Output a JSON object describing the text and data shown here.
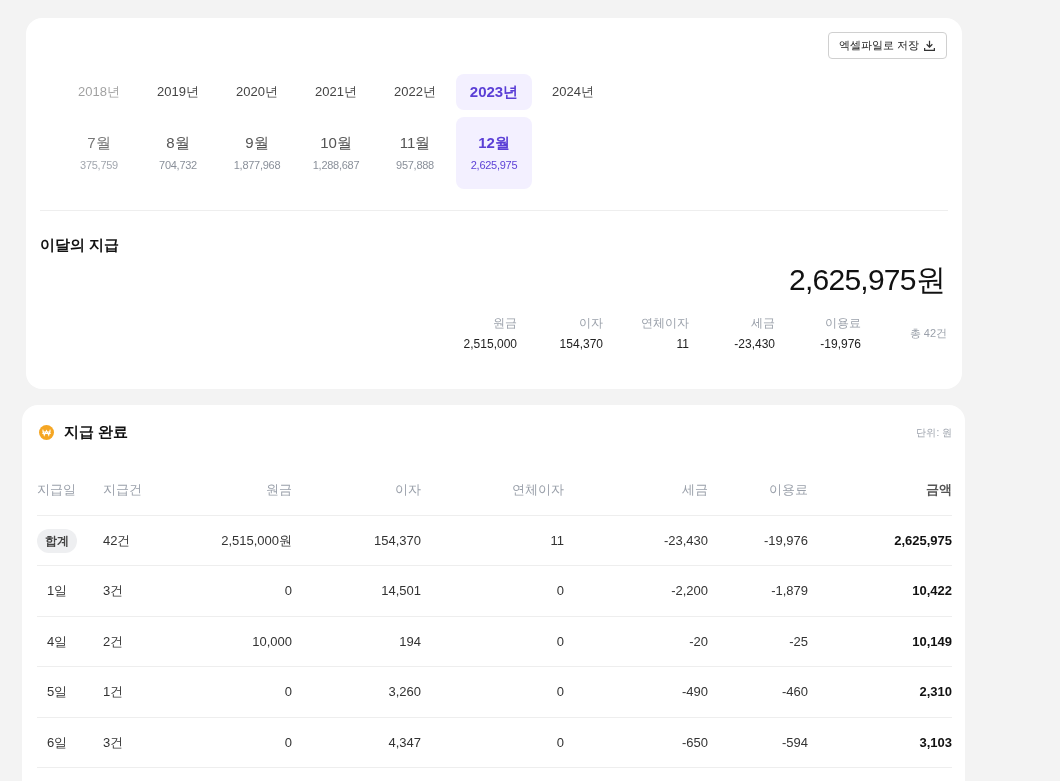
{
  "export_button": {
    "label": "엑셀파일로 저장"
  },
  "years": [
    {
      "label": "2018년",
      "selected": false,
      "faded": true
    },
    {
      "label": "2019년",
      "selected": false,
      "faded": false
    },
    {
      "label": "2020년",
      "selected": false,
      "faded": false
    },
    {
      "label": "2021년",
      "selected": false,
      "faded": false
    },
    {
      "label": "2022년",
      "selected": false,
      "faded": false
    },
    {
      "label": "2023년",
      "selected": true,
      "faded": false
    },
    {
      "label": "2024년",
      "selected": false,
      "faded": false
    }
  ],
  "months": [
    {
      "label": "7월",
      "amount": "375,759",
      "selected": false,
      "faded": true
    },
    {
      "label": "8월",
      "amount": "704,732",
      "selected": false,
      "faded": false
    },
    {
      "label": "9월",
      "amount": "1,877,968",
      "selected": false,
      "faded": false
    },
    {
      "label": "10월",
      "amount": "1,288,687",
      "selected": false,
      "faded": false
    },
    {
      "label": "11월",
      "amount": "957,888",
      "selected": false,
      "faded": false
    },
    {
      "label": "12월",
      "amount": "2,625,975",
      "selected": true,
      "faded": false
    }
  ],
  "summary": {
    "title": "이달의 지급",
    "total": "2,625,975원",
    "breakdown": [
      {
        "label": "원금",
        "value": "2,515,000"
      },
      {
        "label": "이자",
        "value": "154,370"
      },
      {
        "label": "연체이자",
        "value": "11"
      },
      {
        "label": "세금",
        "value": "-23,430"
      },
      {
        "label": "이용료",
        "value": "-19,976"
      }
    ],
    "count": "총 42건"
  },
  "completed": {
    "title": "지급 완료",
    "unit": "단위: 원",
    "columns": [
      "지급일",
      "지급건",
      "원금",
      "이자",
      "연체이자",
      "세금",
      "이용료",
      "금액"
    ],
    "rows": [
      {
        "kind": "total",
        "cells": [
          "합계",
          "42건",
          "2,515,000원",
          "154,370",
          "11",
          "-23,430",
          "-19,976",
          "2,625,975"
        ]
      },
      {
        "kind": "day",
        "cells": [
          "1일",
          "3건",
          "0",
          "14,501",
          "0",
          "-2,200",
          "-1,879",
          "10,422"
        ]
      },
      {
        "kind": "day",
        "cells": [
          "4일",
          "2건",
          "10,000",
          "194",
          "0",
          "-20",
          "-25",
          "10,149"
        ]
      },
      {
        "kind": "day",
        "cells": [
          "5일",
          "1건",
          "0",
          "3,260",
          "0",
          "-490",
          "-460",
          "2,310"
        ]
      },
      {
        "kind": "day",
        "cells": [
          "6일",
          "3건",
          "0",
          "4,347",
          "0",
          "-650",
          "-594",
          "3,103"
        ]
      }
    ]
  }
}
